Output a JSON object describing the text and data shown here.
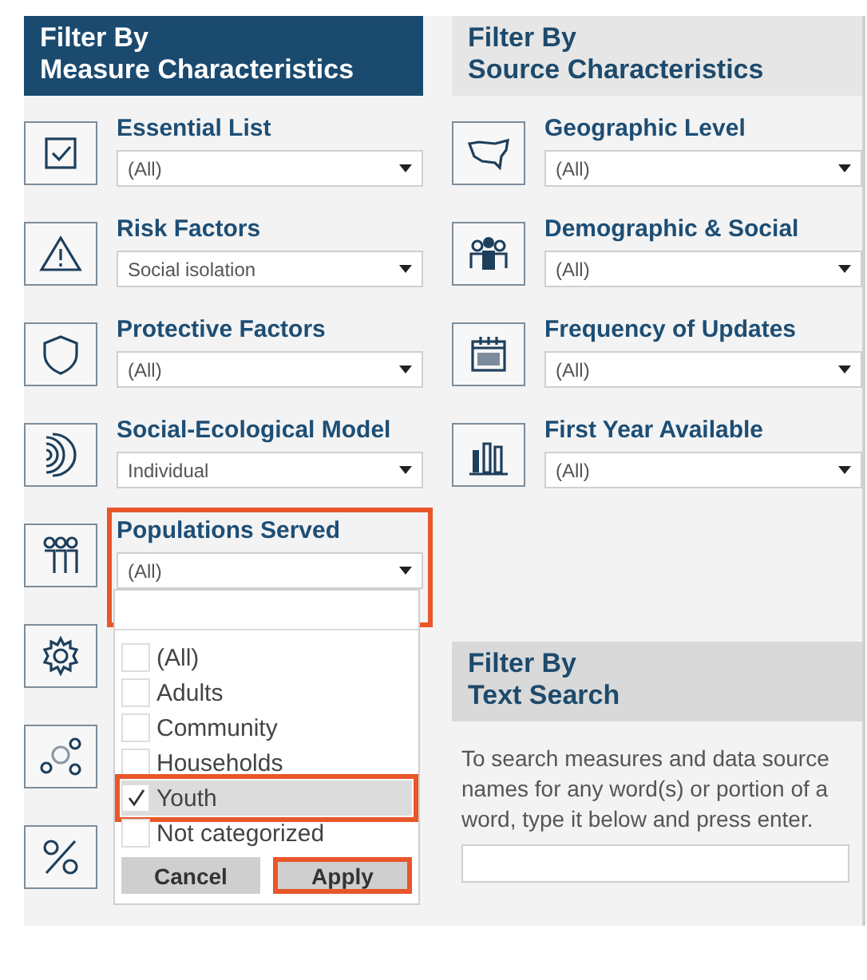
{
  "measure_panel": {
    "title_lines": [
      "Filter By",
      "Measure Characteristics"
    ],
    "filters": [
      {
        "label": "Essential List",
        "value": "(All)",
        "highlighted": false
      },
      {
        "label": "Risk Factors",
        "value": "Social isolation",
        "highlighted": false
      },
      {
        "label": "Protective Factors",
        "value": "(All)",
        "highlighted": false
      },
      {
        "label": "Social-Ecological Model",
        "value": "Individual",
        "highlighted": false
      },
      {
        "label": "Populations Served",
        "value": "(All)",
        "highlighted": true
      }
    ],
    "dropdown": {
      "options": [
        {
          "label": "(All)",
          "checked": false,
          "hovered": false,
          "highlighted": false
        },
        {
          "label": "Adults",
          "checked": false,
          "hovered": false,
          "highlighted": false
        },
        {
          "label": "Community",
          "checked": false,
          "hovered": false,
          "highlighted": false
        },
        {
          "label": "Households",
          "checked": false,
          "hovered": false,
          "highlighted": false
        },
        {
          "label": "Youth",
          "checked": true,
          "hovered": true,
          "highlighted": true
        },
        {
          "label": "Not categorized",
          "checked": false,
          "hovered": false,
          "highlighted": false
        }
      ],
      "buttons": [
        {
          "label": "Cancel",
          "highlighted": false
        },
        {
          "label": "Apply",
          "highlighted": true
        }
      ]
    }
  },
  "source_panel": {
    "title_lines": [
      "Filter By",
      "Source Characteristics"
    ],
    "filters": [
      {
        "label": "Geographic Level",
        "value": "(All)"
      },
      {
        "label": "Demographic & Social",
        "value": "(All)"
      },
      {
        "label": "Frequency of Updates",
        "value": "(All)"
      },
      {
        "label": "First Year Available",
        "value": "(All)"
      }
    ]
  },
  "text_search": {
    "title_lines": [
      "Filter By",
      "Text Search"
    ],
    "description": "To search measures and data source names for any word(s) or portion of a word, type it below and press enter."
  }
}
